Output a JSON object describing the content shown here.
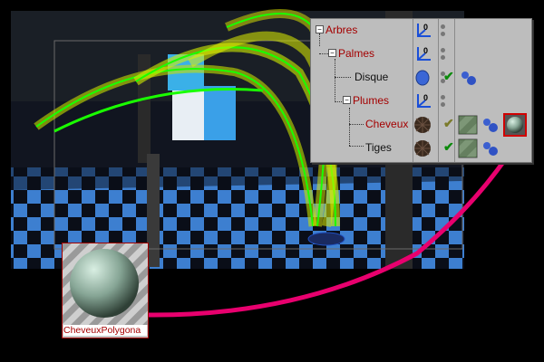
{
  "object_manager": {
    "rows": [
      {
        "name": "Arbres",
        "highlight": false
      },
      {
        "name": "Palmes",
        "highlight": false
      },
      {
        "name": "Disque",
        "highlight": false
      },
      {
        "name": "Plumes",
        "highlight": false
      },
      {
        "name": "Cheveux",
        "highlight": true
      },
      {
        "name": "Tiges",
        "highlight": false
      }
    ]
  },
  "material": {
    "label": "CheveuxPolygona"
  },
  "colors": {
    "accent": "#e8006e",
    "selection": "#a40000"
  },
  "icons": [
    "null-object-icon",
    "disc-icon",
    "hair-icon",
    "material-sphere-icon",
    "check-icon",
    "texture-tag-icon"
  ]
}
